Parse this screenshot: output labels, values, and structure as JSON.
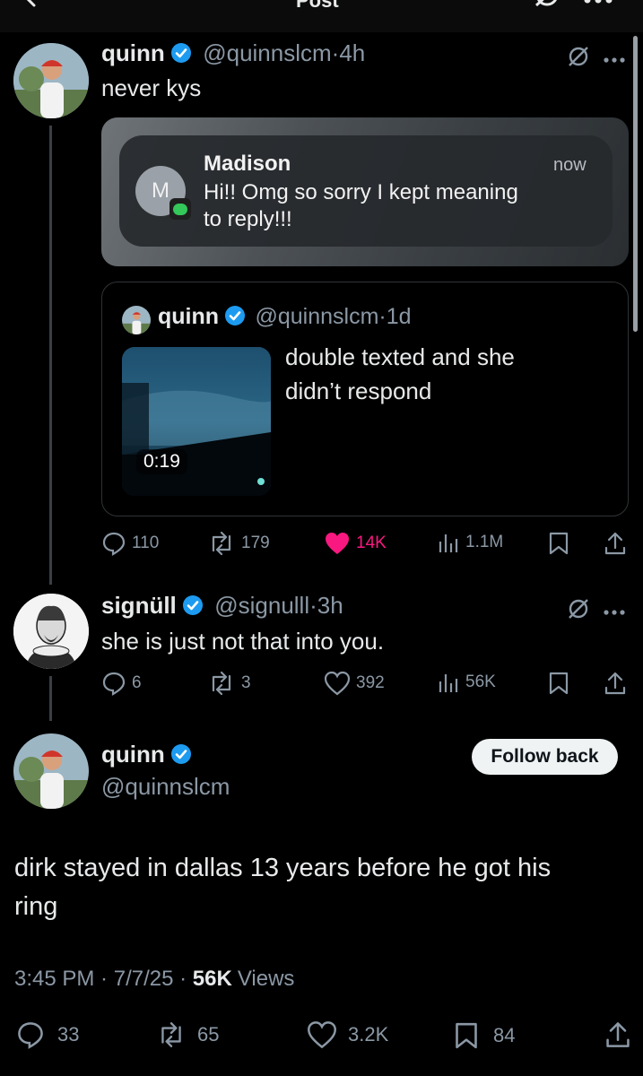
{
  "header": {
    "title": "Post"
  },
  "reply1": {
    "name": "quinn",
    "handle": "@quinnslcm",
    "time": "4h",
    "text": "never kys",
    "notification": {
      "avatar_letter": "M",
      "sender": "Madison",
      "time": "now",
      "message_line1": "Hi!! Omg so sorry I kept meaning",
      "message_line2": "to reply!!!"
    },
    "quote": {
      "name": "quinn",
      "handle": "@quinnslcm",
      "time": "1d",
      "text_line1": "double texted and she",
      "text_line2": "didn’t respond",
      "video_duration": "0:19"
    },
    "actions": {
      "replies": "110",
      "reposts": "179",
      "likes": "14K",
      "views": "1.1M"
    },
    "like_color": "#f91880"
  },
  "reply2": {
    "name": "signüll",
    "handle": "@signulll",
    "time": "3h",
    "text": "she is just not that into you.",
    "actions": {
      "replies": "6",
      "reposts": "3",
      "likes": "392",
      "views": "56K"
    }
  },
  "main_post": {
    "name": "quinn",
    "handle": "@quinnslcm",
    "follow_label": "Follow back",
    "text_line1": "dirk stayed in dallas 13 years before he got his",
    "text_line2": "ring",
    "time": "3:45 PM",
    "date": "7/7/25",
    "views_count": "56K",
    "views_label": "Views",
    "actions": {
      "replies": "33",
      "reposts": "65",
      "likes": "3.2K",
      "bookmarks": "84"
    }
  },
  "colors": {
    "verified": "#1d9bf0",
    "background": "#000000",
    "accent_green": "#34c759"
  }
}
